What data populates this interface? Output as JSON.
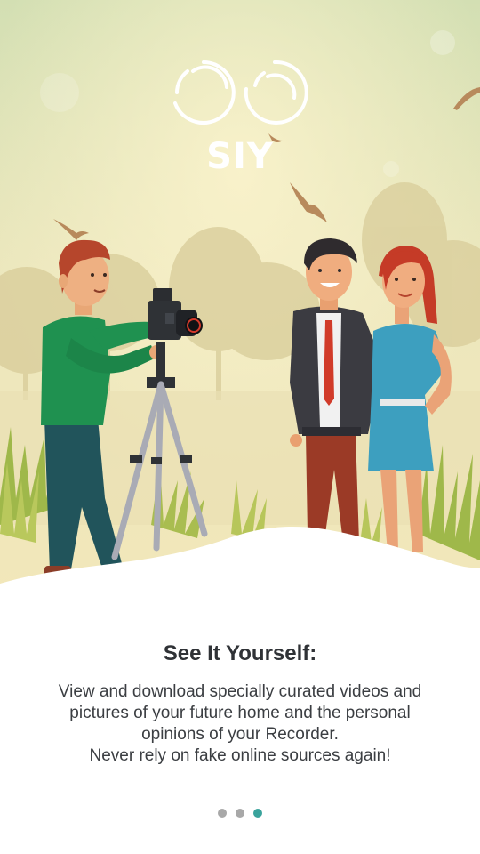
{
  "logo": {
    "text": "SIY"
  },
  "onboarding": {
    "title": "See It Yourself:",
    "description_lines": [
      "View and download specially curated videos and",
      "pictures of your future home and the personal",
      "opinions of your Recorder.",
      "Never rely on fake online sources again!"
    ]
  },
  "pager": {
    "total": 3,
    "active_index": 2
  },
  "colors": {
    "title": "#2f3236",
    "text": "#3b3e42",
    "dot_inactive": "#a8a8a8",
    "dot_active": "#3aa39c",
    "sky_top": "#d3dfb3",
    "sky_mid": "#ece7bd"
  },
  "illustration": {
    "subject": "photographer-filming-couple-outdoors"
  }
}
